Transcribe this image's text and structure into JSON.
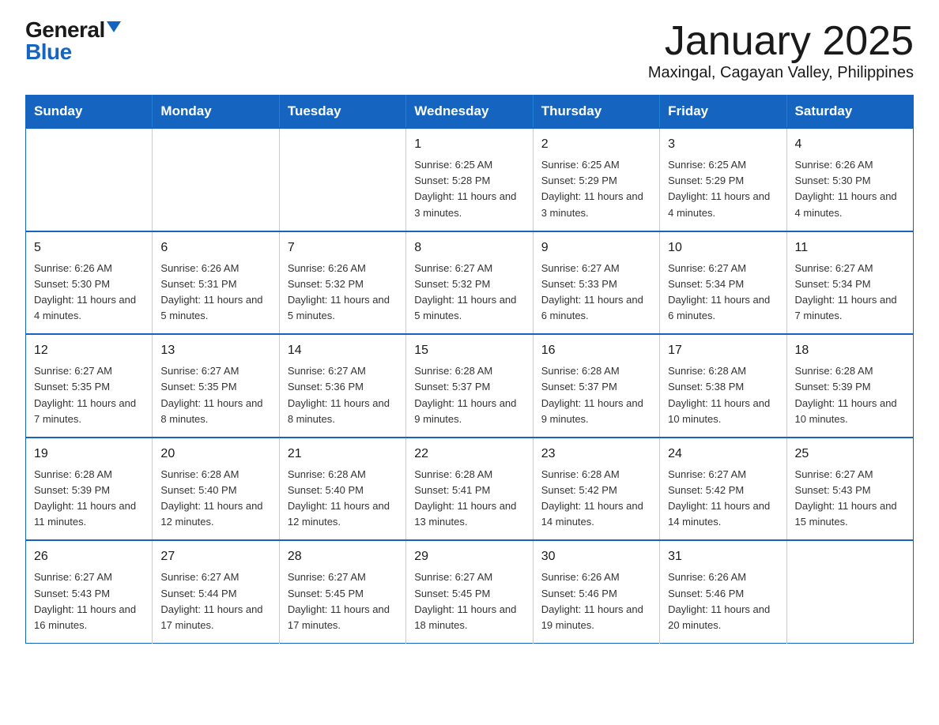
{
  "logo": {
    "general": "General",
    "blue": "Blue"
  },
  "header": {
    "month": "January 2025",
    "location": "Maxingal, Cagayan Valley, Philippines"
  },
  "weekdays": [
    "Sunday",
    "Monday",
    "Tuesday",
    "Wednesday",
    "Thursday",
    "Friday",
    "Saturday"
  ],
  "weeks": [
    [
      {
        "day": "",
        "info": ""
      },
      {
        "day": "",
        "info": ""
      },
      {
        "day": "",
        "info": ""
      },
      {
        "day": "1",
        "info": "Sunrise: 6:25 AM\nSunset: 5:28 PM\nDaylight: 11 hours and 3 minutes."
      },
      {
        "day": "2",
        "info": "Sunrise: 6:25 AM\nSunset: 5:29 PM\nDaylight: 11 hours and 3 minutes."
      },
      {
        "day": "3",
        "info": "Sunrise: 6:25 AM\nSunset: 5:29 PM\nDaylight: 11 hours and 4 minutes."
      },
      {
        "day": "4",
        "info": "Sunrise: 6:26 AM\nSunset: 5:30 PM\nDaylight: 11 hours and 4 minutes."
      }
    ],
    [
      {
        "day": "5",
        "info": "Sunrise: 6:26 AM\nSunset: 5:30 PM\nDaylight: 11 hours and 4 minutes."
      },
      {
        "day": "6",
        "info": "Sunrise: 6:26 AM\nSunset: 5:31 PM\nDaylight: 11 hours and 5 minutes."
      },
      {
        "day": "7",
        "info": "Sunrise: 6:26 AM\nSunset: 5:32 PM\nDaylight: 11 hours and 5 minutes."
      },
      {
        "day": "8",
        "info": "Sunrise: 6:27 AM\nSunset: 5:32 PM\nDaylight: 11 hours and 5 minutes."
      },
      {
        "day": "9",
        "info": "Sunrise: 6:27 AM\nSunset: 5:33 PM\nDaylight: 11 hours and 6 minutes."
      },
      {
        "day": "10",
        "info": "Sunrise: 6:27 AM\nSunset: 5:34 PM\nDaylight: 11 hours and 6 minutes."
      },
      {
        "day": "11",
        "info": "Sunrise: 6:27 AM\nSunset: 5:34 PM\nDaylight: 11 hours and 7 minutes."
      }
    ],
    [
      {
        "day": "12",
        "info": "Sunrise: 6:27 AM\nSunset: 5:35 PM\nDaylight: 11 hours and 7 minutes."
      },
      {
        "day": "13",
        "info": "Sunrise: 6:27 AM\nSunset: 5:35 PM\nDaylight: 11 hours and 8 minutes."
      },
      {
        "day": "14",
        "info": "Sunrise: 6:27 AM\nSunset: 5:36 PM\nDaylight: 11 hours and 8 minutes."
      },
      {
        "day": "15",
        "info": "Sunrise: 6:28 AM\nSunset: 5:37 PM\nDaylight: 11 hours and 9 minutes."
      },
      {
        "day": "16",
        "info": "Sunrise: 6:28 AM\nSunset: 5:37 PM\nDaylight: 11 hours and 9 minutes."
      },
      {
        "day": "17",
        "info": "Sunrise: 6:28 AM\nSunset: 5:38 PM\nDaylight: 11 hours and 10 minutes."
      },
      {
        "day": "18",
        "info": "Sunrise: 6:28 AM\nSunset: 5:39 PM\nDaylight: 11 hours and 10 minutes."
      }
    ],
    [
      {
        "day": "19",
        "info": "Sunrise: 6:28 AM\nSunset: 5:39 PM\nDaylight: 11 hours and 11 minutes."
      },
      {
        "day": "20",
        "info": "Sunrise: 6:28 AM\nSunset: 5:40 PM\nDaylight: 11 hours and 12 minutes."
      },
      {
        "day": "21",
        "info": "Sunrise: 6:28 AM\nSunset: 5:40 PM\nDaylight: 11 hours and 12 minutes."
      },
      {
        "day": "22",
        "info": "Sunrise: 6:28 AM\nSunset: 5:41 PM\nDaylight: 11 hours and 13 minutes."
      },
      {
        "day": "23",
        "info": "Sunrise: 6:28 AM\nSunset: 5:42 PM\nDaylight: 11 hours and 14 minutes."
      },
      {
        "day": "24",
        "info": "Sunrise: 6:27 AM\nSunset: 5:42 PM\nDaylight: 11 hours and 14 minutes."
      },
      {
        "day": "25",
        "info": "Sunrise: 6:27 AM\nSunset: 5:43 PM\nDaylight: 11 hours and 15 minutes."
      }
    ],
    [
      {
        "day": "26",
        "info": "Sunrise: 6:27 AM\nSunset: 5:43 PM\nDaylight: 11 hours and 16 minutes."
      },
      {
        "day": "27",
        "info": "Sunrise: 6:27 AM\nSunset: 5:44 PM\nDaylight: 11 hours and 17 minutes."
      },
      {
        "day": "28",
        "info": "Sunrise: 6:27 AM\nSunset: 5:45 PM\nDaylight: 11 hours and 17 minutes."
      },
      {
        "day": "29",
        "info": "Sunrise: 6:27 AM\nSunset: 5:45 PM\nDaylight: 11 hours and 18 minutes."
      },
      {
        "day": "30",
        "info": "Sunrise: 6:26 AM\nSunset: 5:46 PM\nDaylight: 11 hours and 19 minutes."
      },
      {
        "day": "31",
        "info": "Sunrise: 6:26 AM\nSunset: 5:46 PM\nDaylight: 11 hours and 20 minutes."
      },
      {
        "day": "",
        "info": ""
      }
    ]
  ]
}
